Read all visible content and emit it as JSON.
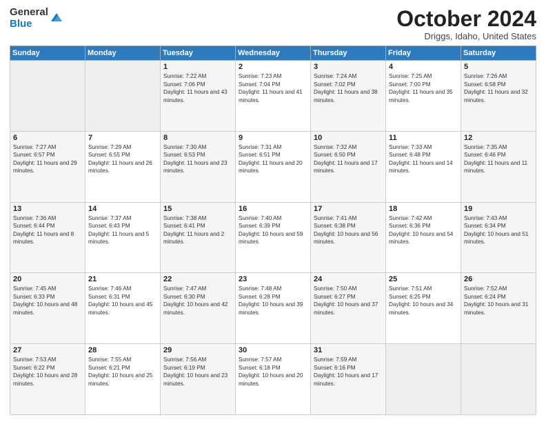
{
  "header": {
    "logo_general": "General",
    "logo_blue": "Blue",
    "title": "October 2024",
    "location": "Driggs, Idaho, United States"
  },
  "weekdays": [
    "Sunday",
    "Monday",
    "Tuesday",
    "Wednesday",
    "Thursday",
    "Friday",
    "Saturday"
  ],
  "weeks": [
    [
      {
        "day": "",
        "sunrise": "",
        "sunset": "",
        "daylight": ""
      },
      {
        "day": "",
        "sunrise": "",
        "sunset": "",
        "daylight": ""
      },
      {
        "day": "1",
        "sunrise": "Sunrise: 7:22 AM",
        "sunset": "Sunset: 7:06 PM",
        "daylight": "Daylight: 11 hours and 43 minutes."
      },
      {
        "day": "2",
        "sunrise": "Sunrise: 7:23 AM",
        "sunset": "Sunset: 7:04 PM",
        "daylight": "Daylight: 11 hours and 41 minutes."
      },
      {
        "day": "3",
        "sunrise": "Sunrise: 7:24 AM",
        "sunset": "Sunset: 7:02 PM",
        "daylight": "Daylight: 11 hours and 38 minutes."
      },
      {
        "day": "4",
        "sunrise": "Sunrise: 7:25 AM",
        "sunset": "Sunset: 7:00 PM",
        "daylight": "Daylight: 11 hours and 35 minutes."
      },
      {
        "day": "5",
        "sunrise": "Sunrise: 7:26 AM",
        "sunset": "Sunset: 6:58 PM",
        "daylight": "Daylight: 11 hours and 32 minutes."
      }
    ],
    [
      {
        "day": "6",
        "sunrise": "Sunrise: 7:27 AM",
        "sunset": "Sunset: 6:57 PM",
        "daylight": "Daylight: 11 hours and 29 minutes."
      },
      {
        "day": "7",
        "sunrise": "Sunrise: 7:29 AM",
        "sunset": "Sunset: 6:55 PM",
        "daylight": "Daylight: 11 hours and 26 minutes."
      },
      {
        "day": "8",
        "sunrise": "Sunrise: 7:30 AM",
        "sunset": "Sunset: 6:53 PM",
        "daylight": "Daylight: 11 hours and 23 minutes."
      },
      {
        "day": "9",
        "sunrise": "Sunrise: 7:31 AM",
        "sunset": "Sunset: 6:51 PM",
        "daylight": "Daylight: 11 hours and 20 minutes."
      },
      {
        "day": "10",
        "sunrise": "Sunrise: 7:32 AM",
        "sunset": "Sunset: 6:50 PM",
        "daylight": "Daylight: 11 hours and 17 minutes."
      },
      {
        "day": "11",
        "sunrise": "Sunrise: 7:33 AM",
        "sunset": "Sunset: 6:48 PM",
        "daylight": "Daylight: 11 hours and 14 minutes."
      },
      {
        "day": "12",
        "sunrise": "Sunrise: 7:35 AM",
        "sunset": "Sunset: 6:46 PM",
        "daylight": "Daylight: 11 hours and 11 minutes."
      }
    ],
    [
      {
        "day": "13",
        "sunrise": "Sunrise: 7:36 AM",
        "sunset": "Sunset: 6:44 PM",
        "daylight": "Daylight: 11 hours and 8 minutes."
      },
      {
        "day": "14",
        "sunrise": "Sunrise: 7:37 AM",
        "sunset": "Sunset: 6:43 PM",
        "daylight": "Daylight: 11 hours and 5 minutes."
      },
      {
        "day": "15",
        "sunrise": "Sunrise: 7:38 AM",
        "sunset": "Sunset: 6:41 PM",
        "daylight": "Daylight: 11 hours and 2 minutes."
      },
      {
        "day": "16",
        "sunrise": "Sunrise: 7:40 AM",
        "sunset": "Sunset: 6:39 PM",
        "daylight": "Daylight: 10 hours and 59 minutes."
      },
      {
        "day": "17",
        "sunrise": "Sunrise: 7:41 AM",
        "sunset": "Sunset: 6:38 PM",
        "daylight": "Daylight: 10 hours and 56 minutes."
      },
      {
        "day": "18",
        "sunrise": "Sunrise: 7:42 AM",
        "sunset": "Sunset: 6:36 PM",
        "daylight": "Daylight: 10 hours and 54 minutes."
      },
      {
        "day": "19",
        "sunrise": "Sunrise: 7:43 AM",
        "sunset": "Sunset: 6:34 PM",
        "daylight": "Daylight: 10 hours and 51 minutes."
      }
    ],
    [
      {
        "day": "20",
        "sunrise": "Sunrise: 7:45 AM",
        "sunset": "Sunset: 6:33 PM",
        "daylight": "Daylight: 10 hours and 48 minutes."
      },
      {
        "day": "21",
        "sunrise": "Sunrise: 7:46 AM",
        "sunset": "Sunset: 6:31 PM",
        "daylight": "Daylight: 10 hours and 45 minutes."
      },
      {
        "day": "22",
        "sunrise": "Sunrise: 7:47 AM",
        "sunset": "Sunset: 6:30 PM",
        "daylight": "Daylight: 10 hours and 42 minutes."
      },
      {
        "day": "23",
        "sunrise": "Sunrise: 7:48 AM",
        "sunset": "Sunset: 6:28 PM",
        "daylight": "Daylight: 10 hours and 39 minutes."
      },
      {
        "day": "24",
        "sunrise": "Sunrise: 7:50 AM",
        "sunset": "Sunset: 6:27 PM",
        "daylight": "Daylight: 10 hours and 37 minutes."
      },
      {
        "day": "25",
        "sunrise": "Sunrise: 7:51 AM",
        "sunset": "Sunset: 6:25 PM",
        "daylight": "Daylight: 10 hours and 34 minutes."
      },
      {
        "day": "26",
        "sunrise": "Sunrise: 7:52 AM",
        "sunset": "Sunset: 6:24 PM",
        "daylight": "Daylight: 10 hours and 31 minutes."
      }
    ],
    [
      {
        "day": "27",
        "sunrise": "Sunrise: 7:53 AM",
        "sunset": "Sunset: 6:22 PM",
        "daylight": "Daylight: 10 hours and 28 minutes."
      },
      {
        "day": "28",
        "sunrise": "Sunrise: 7:55 AM",
        "sunset": "Sunset: 6:21 PM",
        "daylight": "Daylight: 10 hours and 25 minutes."
      },
      {
        "day": "29",
        "sunrise": "Sunrise: 7:56 AM",
        "sunset": "Sunset: 6:19 PM",
        "daylight": "Daylight: 10 hours and 23 minutes."
      },
      {
        "day": "30",
        "sunrise": "Sunrise: 7:57 AM",
        "sunset": "Sunset: 6:18 PM",
        "daylight": "Daylight: 10 hours and 20 minutes."
      },
      {
        "day": "31",
        "sunrise": "Sunrise: 7:59 AM",
        "sunset": "Sunset: 6:16 PM",
        "daylight": "Daylight: 10 hours and 17 minutes."
      },
      {
        "day": "",
        "sunrise": "",
        "sunset": "",
        "daylight": ""
      },
      {
        "day": "",
        "sunrise": "",
        "sunset": "",
        "daylight": ""
      }
    ]
  ]
}
